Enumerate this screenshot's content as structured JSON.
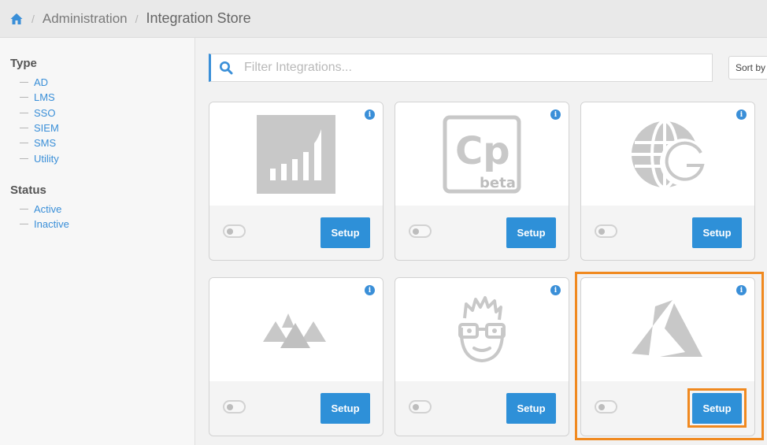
{
  "breadcrumb": {
    "home_icon": "home-icon",
    "items": [
      "Administration",
      "Integration Store"
    ]
  },
  "sidebar": {
    "type_heading": "Type",
    "type_items": [
      "AD",
      "LMS",
      "SSO",
      "SIEM",
      "SMS",
      "Utility"
    ],
    "status_heading": "Status",
    "status_items": [
      "Active",
      "Inactive"
    ]
  },
  "search": {
    "placeholder": "Filter Integrations...",
    "value": ""
  },
  "sort_button": "Sort by",
  "cards": [
    {
      "logo": "signal-bars-logo",
      "setup_label": "Setup",
      "enabled": false
    },
    {
      "logo": "cp-beta-logo",
      "logo_text": "Cp",
      "logo_subtext": "beta",
      "setup_label": "Setup",
      "enabled": false
    },
    {
      "logo": "globe-g-logo",
      "setup_label": "Setup",
      "enabled": false
    },
    {
      "logo": "mountains-logo",
      "setup_label": "Setup",
      "enabled": false
    },
    {
      "logo": "nerd-face-logo",
      "setup_label": "Setup",
      "enabled": false
    },
    {
      "logo": "azure-logo",
      "setup_label": "Setup",
      "enabled": false
    }
  ],
  "colors": {
    "accent": "#2e90d8",
    "highlight": "#f0891f",
    "logo_gray": "#c8c8c8"
  }
}
